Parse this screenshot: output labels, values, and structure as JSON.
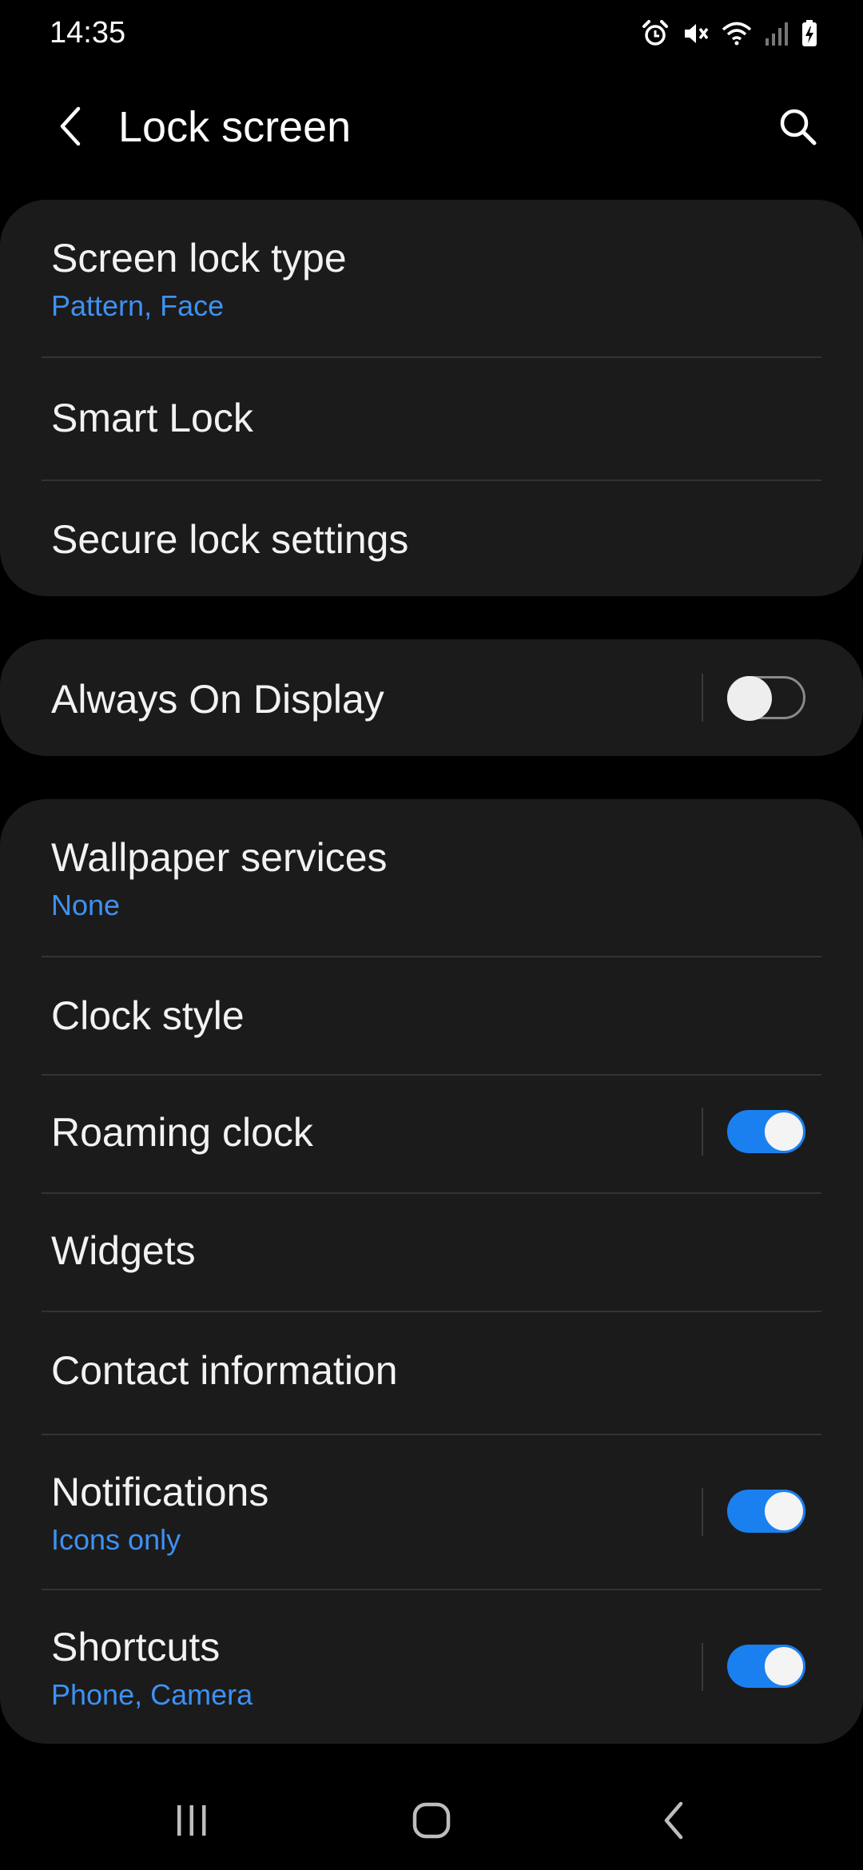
{
  "status_bar": {
    "time": "14:35",
    "icons": [
      "alarm-icon",
      "mute-icon",
      "wifi-icon",
      "signal-icon",
      "battery-charging-icon"
    ]
  },
  "header": {
    "title": "Lock screen",
    "back_icon": "back-icon",
    "search_icon": "search-icon"
  },
  "groups": [
    {
      "items": [
        {
          "label": "Screen lock type",
          "subtitle": "Pattern, Face"
        },
        {
          "label": "Smart Lock"
        },
        {
          "label": "Secure lock settings"
        }
      ]
    },
    {
      "items": [
        {
          "label": "Always On Display",
          "toggle": false
        }
      ]
    },
    {
      "items": [
        {
          "label": "Wallpaper services",
          "subtitle": "None"
        },
        {
          "label": "Clock style"
        },
        {
          "label": "Roaming clock",
          "toggle": true
        },
        {
          "label": "Widgets"
        },
        {
          "label": "Contact information"
        },
        {
          "label": "Notifications",
          "subtitle": "Icons only",
          "toggle": true
        },
        {
          "label": "Shortcuts",
          "subtitle": "Phone, Camera",
          "toggle": true
        }
      ]
    }
  ],
  "nav_bar": {
    "buttons": [
      "recents-icon",
      "home-icon",
      "back-nav-icon"
    ]
  },
  "colors": {
    "background": "#000000",
    "card": "#1b1b1b",
    "accent_text": "#3e91f2",
    "toggle_on": "#1a80f0"
  }
}
